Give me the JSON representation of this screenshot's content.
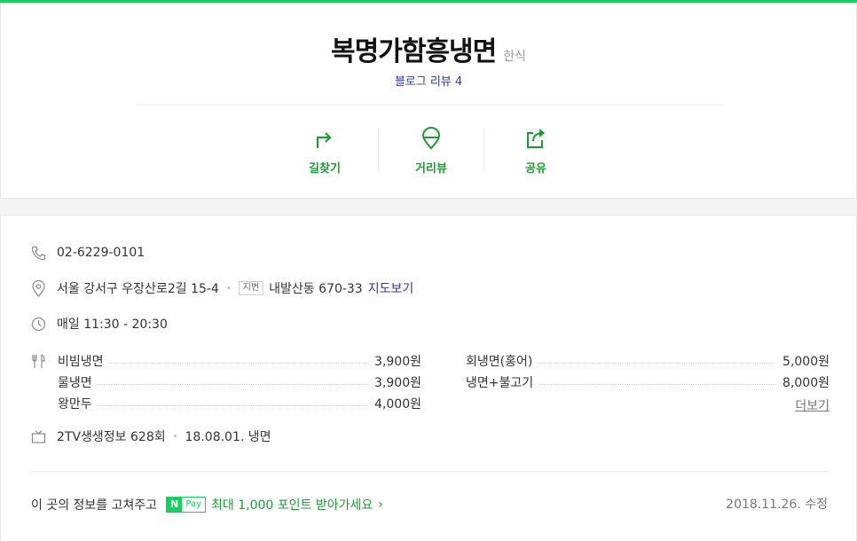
{
  "header": {
    "name": "복명가함흥냉면",
    "category": "한식",
    "blog_review": "블로그 리뷰 4"
  },
  "actions": [
    {
      "label": "길찾기",
      "icon": "directions-icon"
    },
    {
      "label": "거리뷰",
      "icon": "street-view-pin-icon"
    },
    {
      "label": "공유",
      "icon": "share-icon"
    }
  ],
  "info": {
    "phone": "02-6229-0101",
    "address": "서울 강서구 우장산로2길 15-4",
    "jibun_badge": "지번",
    "jibun_address": "내발산동 670-33",
    "map_link": "지도보기",
    "hours": "매일 11:30 - 20:30",
    "tv_show": "2TV생생정보 628회",
    "tv_date": "18.08.01. 냉면"
  },
  "menu": {
    "items": [
      {
        "name": "비빔냉면",
        "price": "3,900원"
      },
      {
        "name": "회냉면(홍어)",
        "price": "5,000원"
      },
      {
        "name": "물냉면",
        "price": "3,900원"
      },
      {
        "name": "냉면+불고기",
        "price": "8,000원"
      },
      {
        "name": "왕만두",
        "price": "4,000원"
      }
    ],
    "more": "더보기"
  },
  "footer": {
    "prompt": "이 곳의 정보를 고쳐주고",
    "npay_n": "N",
    "npay_pay": "Pay",
    "promo": "최대 1,000 포인트 받아가세요",
    "chevron": "›",
    "updated": "2018.11.26. 수정"
  },
  "colors": {
    "accent_green": "#19ce60",
    "action_green": "#1c9b35",
    "link_blue": "#2f3e97"
  }
}
